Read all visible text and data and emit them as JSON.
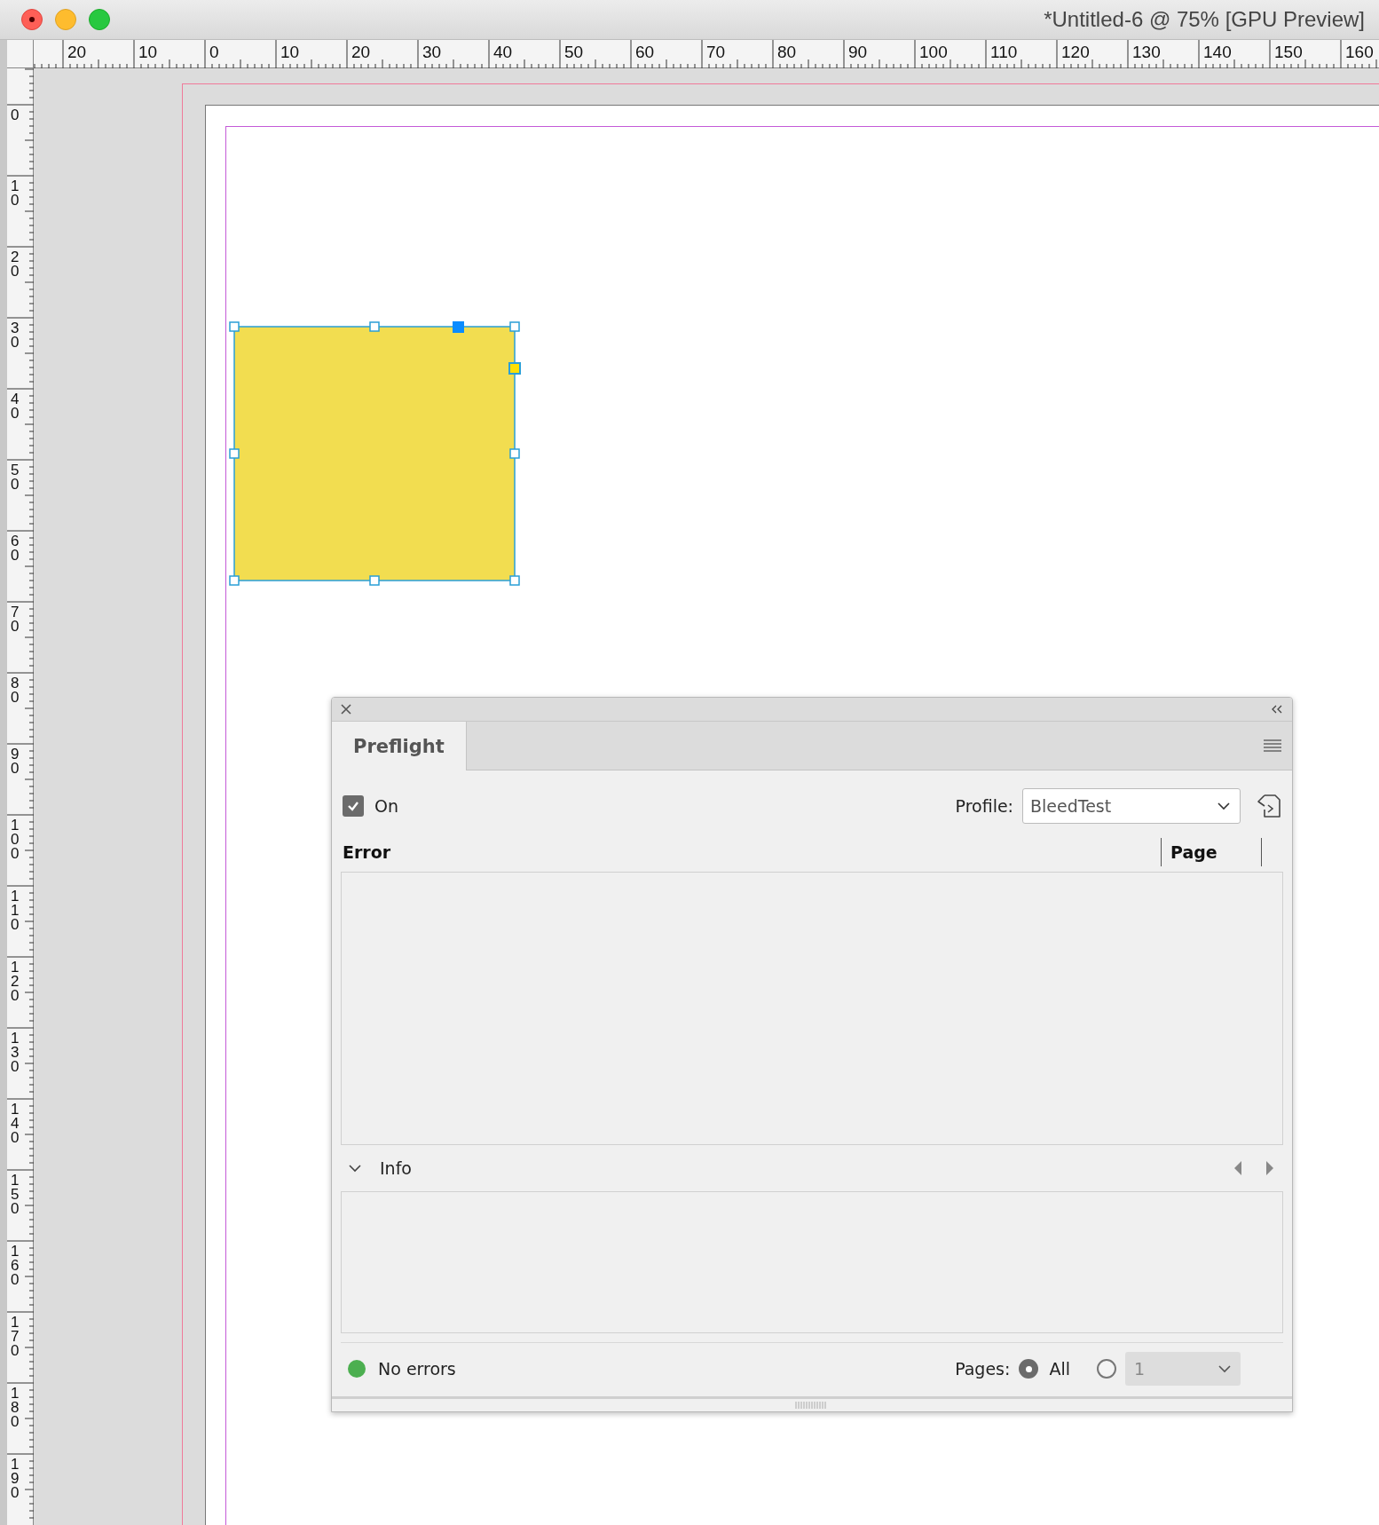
{
  "window": {
    "title": "*Untitled-6 @ 75% [GPU Preview]"
  },
  "rulers": {
    "top_labels": [
      "20",
      "10",
      "0",
      "10",
      "20",
      "30",
      "40",
      "50",
      "60",
      "70",
      "80",
      "90",
      "100",
      "110",
      "120",
      "130",
      "140",
      "150",
      "160"
    ],
    "left_labels": [
      "0",
      "10",
      "20",
      "30",
      "40",
      "50",
      "60",
      "70",
      "80",
      "90",
      "100",
      "110",
      "120",
      "130",
      "140",
      "150",
      "160",
      "170",
      "180",
      "190"
    ]
  },
  "canvas": {
    "frame": {
      "selected": true
    }
  },
  "panel": {
    "tabs": [
      {
        "label": "Preflight",
        "selected": true
      }
    ],
    "on": {
      "label": "On",
      "checked": true
    },
    "profile": {
      "label": "Profile:",
      "value": "BleedTest"
    },
    "columns": [
      "Error",
      "Page"
    ],
    "info": {
      "label": "Info",
      "expanded": true
    },
    "status": {
      "text": "No errors",
      "color": "#4caf50"
    },
    "pages": {
      "label": "Pages:",
      "options": [
        {
          "kind": "radio",
          "label": "All",
          "selected": true
        },
        {
          "kind": "range",
          "value": "1",
          "selected": false
        }
      ]
    }
  }
}
